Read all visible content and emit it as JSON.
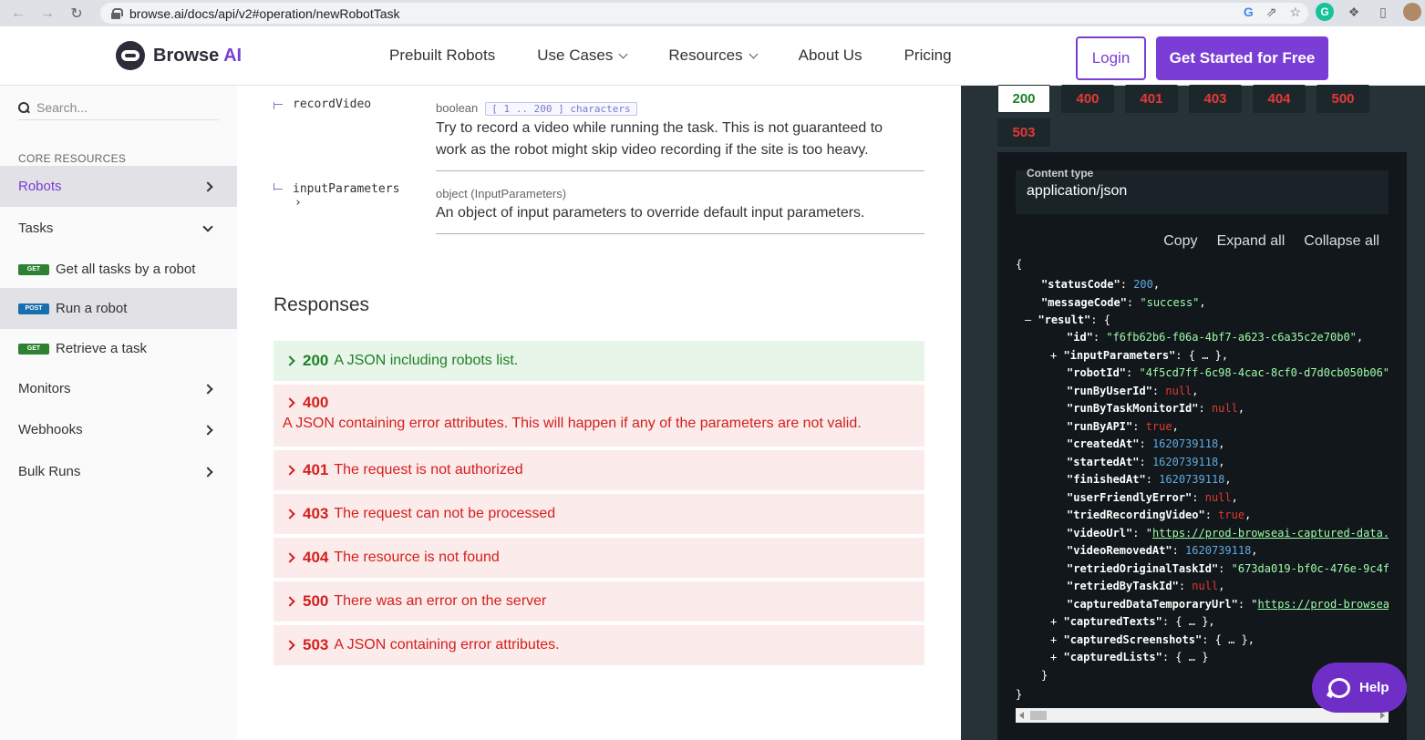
{
  "browser": {
    "url": "browse.ai/docs/api/v2#operation/newRobotTask"
  },
  "header": {
    "logo_text": "Browse",
    "logo_accent": "AI",
    "nav": [
      "Prebuilt Robots",
      "Use Cases",
      "Resources",
      "About Us",
      "Pricing"
    ],
    "login": "Login",
    "cta": "Get Started for Free"
  },
  "sidebar": {
    "search_placeholder": "Search...",
    "section": "CORE RESOURCES",
    "items": [
      {
        "label": "Robots"
      },
      {
        "label": "Tasks"
      },
      {
        "label": "Get all tasks by a robot",
        "badge": "GET"
      },
      {
        "label": "Run a robot",
        "badge": "POST"
      },
      {
        "label": "Retrieve a task",
        "badge": "GET"
      },
      {
        "label": "Monitors"
      },
      {
        "label": "Webhooks"
      },
      {
        "label": "Bulk Runs"
      }
    ]
  },
  "params": [
    {
      "name": "recordVideo",
      "type": "boolean",
      "constraint": "[ 1 .. 200 ] characters",
      "desc1": "Try to record a video while running the task. This is not guaranteed to",
      "desc2": "work as the robot might skip video recording if the site is too heavy."
    },
    {
      "name": "inputParameters",
      "expand": "›",
      "type": "object (InputParameters)",
      "desc1": "An object of input parameters to override default input parameters."
    }
  ],
  "responses": {
    "title": "Responses",
    "items": [
      {
        "code": "200",
        "text": "A JSON including robots list."
      },
      {
        "code": "400",
        "text": "A JSON containing error attributes. This will happen if any of the parameters are not valid."
      },
      {
        "code": "401",
        "text": "The request is not authorized"
      },
      {
        "code": "403",
        "text": "The request can not be processed"
      },
      {
        "code": "404",
        "text": "The resource is not found"
      },
      {
        "code": "500",
        "text": "There was an error on the server"
      },
      {
        "code": "503",
        "text": "A JSON containing error attributes."
      }
    ]
  },
  "right_panel": {
    "tabs": [
      "200",
      "400",
      "401",
      "403",
      "404",
      "500",
      "503"
    ],
    "content_type_label": "Content type",
    "content_type": "application/json",
    "actions": [
      "Copy",
      "Expand all",
      "Collapse all"
    ]
  },
  "help": "Help"
}
